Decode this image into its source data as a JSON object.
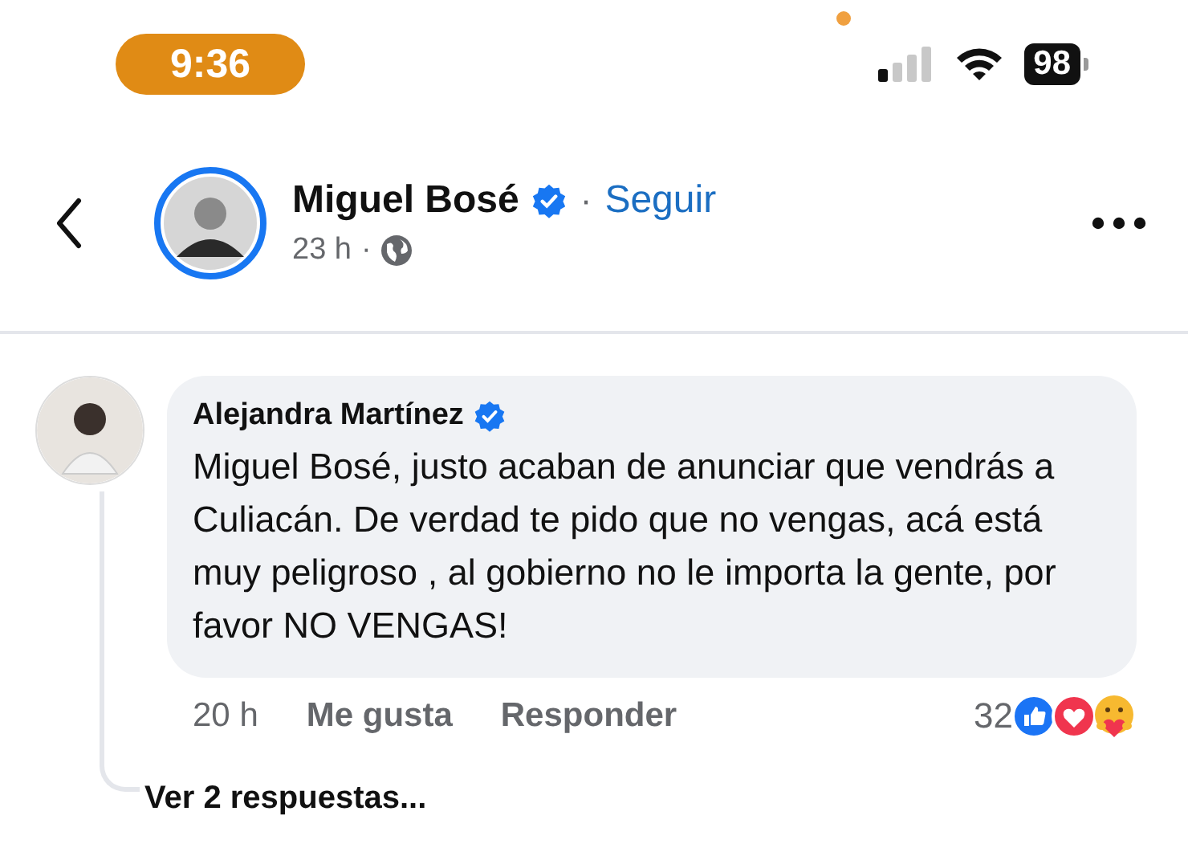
{
  "status_bar": {
    "time": "9:36",
    "battery": "98"
  },
  "post_header": {
    "author": "Miguel Bosé",
    "verified": true,
    "follow_separator": "·",
    "follow": "Seguir",
    "time": "23 h",
    "time_separator": "·"
  },
  "comments": [
    {
      "author": "Alejandra Martínez",
      "verified": true,
      "text": "Miguel Bosé, justo acaban de anunciar que vendrás a Culiacán. De verdad te pido que no vengas, acá está muy peligroso , al gobierno no le importa la gente, por favor NO VENGAS!",
      "time": "20 h",
      "like": "Me gusta",
      "reply": "Responder",
      "reaction_count": "32",
      "replies_link": "Ver 2 respuestas..."
    }
  ]
}
